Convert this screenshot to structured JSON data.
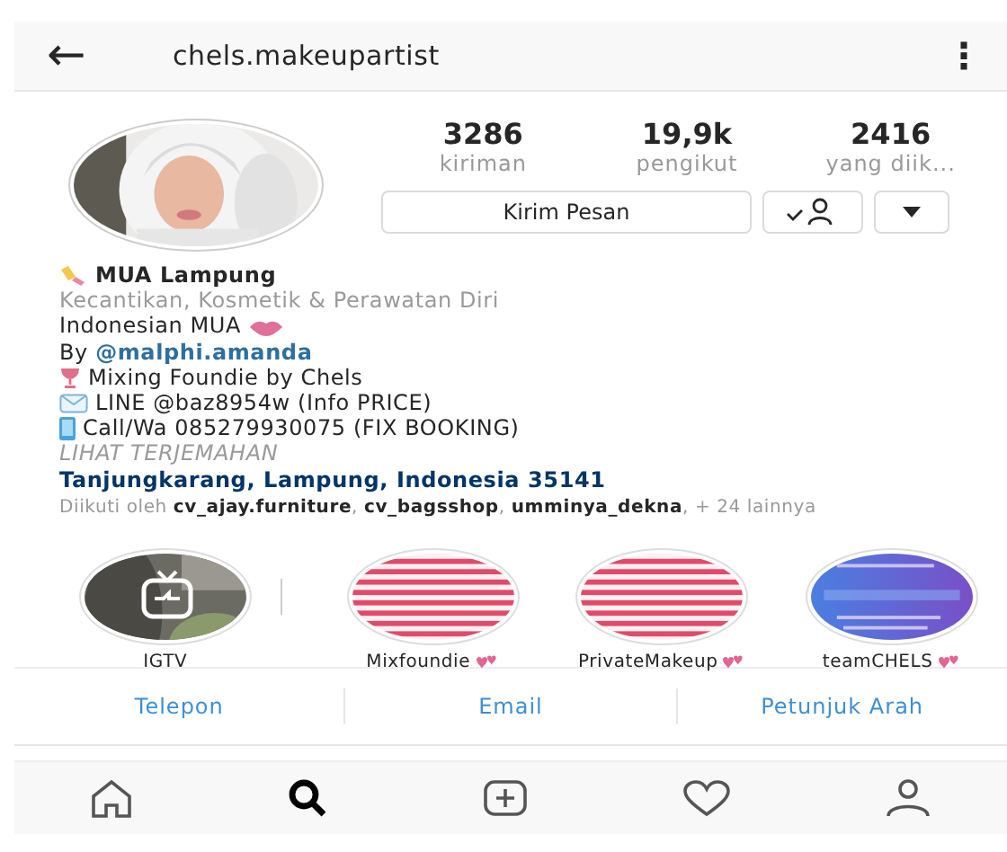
{
  "top_bar": {
    "back": "←",
    "username": "chels.makeupartist",
    "menu": "⋮"
  },
  "stats": [
    {
      "value": "3286",
      "label": "kiriman"
    },
    {
      "value": "19,9k",
      "label": "pengikut"
    },
    {
      "value": "2416",
      "label": "yang diik..."
    }
  ],
  "actions": {
    "message": "Kirim Pesan"
  },
  "bio": {
    "name": "MUA Lampung",
    "category": "Kecantikan, Kosmetik & Perawatan Diri",
    "lines": [
      {
        "kind": "plain",
        "text": "Indonesian MUA"
      },
      {
        "kind": "mention",
        "text": "By ",
        "link": "@malphi.amanda"
      },
      {
        "kind": "plain",
        "text": "Mixing Foundie by Chels"
      },
      {
        "kind": "plain",
        "text": "LINE @baz8954w (Info PRICE)"
      },
      {
        "kind": "plain",
        "text": "Call/Wa 085279930075 (FIX BOOKING)"
      }
    ],
    "translate": "LIHAT TERJEMAHAN",
    "address": "Tanjungkarang, Lampung, Indonesia 35141",
    "followed_by": "Diikuti oleh **cv_ajay.furniture**, **cv_bagsshop**, **umminya_dekna**, + 24 lainnya"
  },
  "highlights": [
    {
      "kind": "igtv",
      "label": "IGTV"
    },
    {
      "kind": "stripes",
      "label": "Mixfoundie"
    },
    {
      "kind": "stripes",
      "label": "PrivateMakeup"
    },
    {
      "kind": "cover",
      "label": "teamCHELS"
    }
  ],
  "contacts": [
    "Telepon",
    "Email",
    "Petunjuk Arah"
  ],
  "nav": [
    {
      "selected": false
    },
    {
      "selected": true
    },
    {
      "selected": false
    },
    {
      "selected": false
    },
    {
      "selected": false
    }
  ]
}
